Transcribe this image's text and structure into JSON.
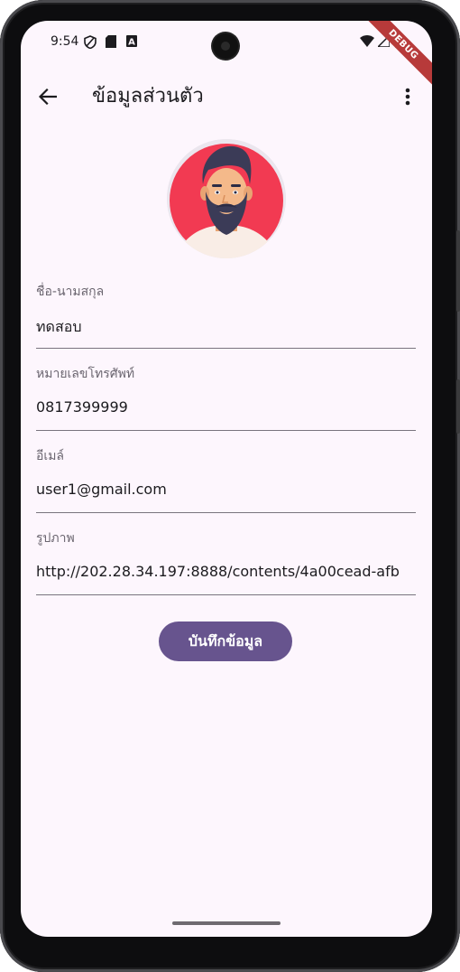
{
  "status_bar": {
    "time": "9:54",
    "icons": [
      "shield-icon",
      "sd-card-icon",
      "a-notification-icon",
      "wifi-icon",
      "cell-signal-icon",
      "battery-icon"
    ]
  },
  "debug_banner": "DEBUG",
  "app_bar": {
    "title": "ข้อมูลส่วนตัว",
    "back_icon": "arrow-back-icon",
    "menu_icon": "more-vert-icon"
  },
  "profile": {
    "avatar_icon": "bearded-man-avatar"
  },
  "form": {
    "fields": [
      {
        "label": "ชื่อ-นามสกุล",
        "value": "ทดสอบ"
      },
      {
        "label": "หมายเลขโทรศัพท์",
        "value": "0817399999"
      },
      {
        "label": "อีเมล์",
        "value": "user1@gmail.com"
      },
      {
        "label": "รูปภาพ",
        "value": "http://202.28.34.197:8888/contents/4a00cead-afb"
      }
    ],
    "save_label": "บันทึกข้อมูล"
  },
  "colors": {
    "background": "#fdf6fd",
    "primary": "#67548e",
    "avatar_ring": "#f0394f"
  }
}
